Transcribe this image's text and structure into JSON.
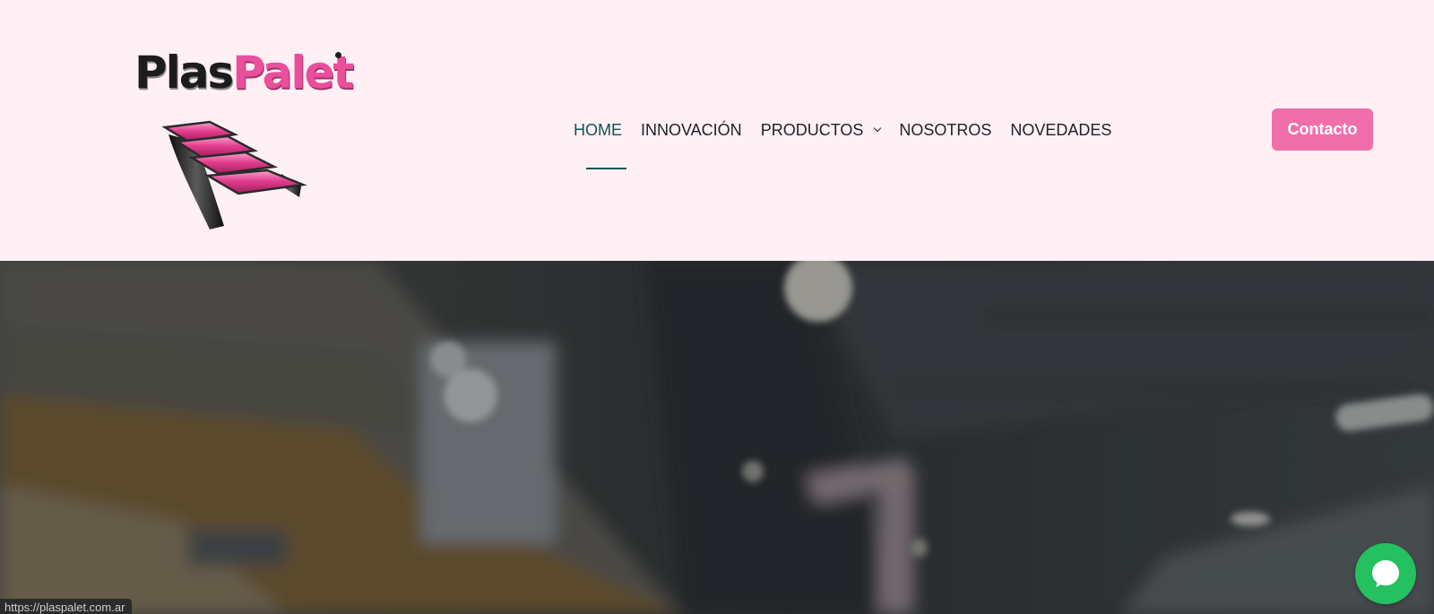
{
  "brand": {
    "logo_part1": "Plas",
    "logo_part2": "Palet",
    "colors": {
      "pink": "#ea4f9b",
      "dark": "#1c1c1c",
      "teal": "#0f5557"
    }
  },
  "nav": {
    "items": [
      {
        "label": "HOME",
        "active": true
      },
      {
        "label": "INNOVACIÓN",
        "active": false
      },
      {
        "label": "PRODUCTOS",
        "active": false,
        "icon": "chevron-down-icon"
      },
      {
        "label": "NOSOTROS",
        "active": false
      },
      {
        "label": "NOVEDADES",
        "active": false
      }
    ]
  },
  "header": {
    "contact_label": "Contacto",
    "contact_color": "#f06fab"
  },
  "floating": {
    "chat_icon": "chat-bubble-icon",
    "chat_color": "#25c05f"
  },
  "status_bar": {
    "url": "https://plaspalet.com.ar"
  }
}
